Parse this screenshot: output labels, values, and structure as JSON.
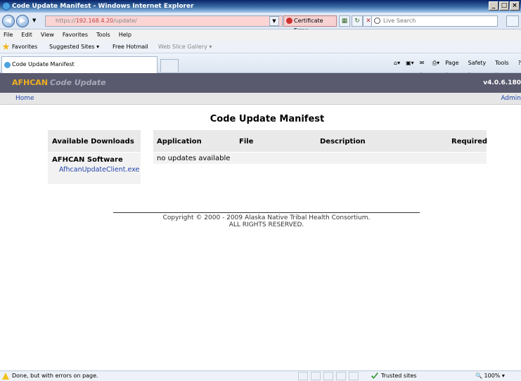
{
  "window": {
    "title": "Code Update Manifest - Windows Internet Explorer"
  },
  "address_bar": {
    "url_scheme": "https://",
    "url_host": "192.168.4.20",
    "url_path": "/update/",
    "cert_error_label": "Certificate Error",
    "search_placeholder": "Live Search"
  },
  "menu": [
    "File",
    "Edit",
    "View",
    "Favorites",
    "Tools",
    "Help"
  ],
  "favorites_bar": {
    "favorites_label": "Favorites",
    "items": [
      "Suggested Sites ▾",
      "Free Hotmail",
      "Web Slice Gallery ▾"
    ]
  },
  "tabs": {
    "active_tab_label": "Code Update Manifest"
  },
  "command_bar": [
    "Page ▾",
    "Safety ▾",
    "Tools ▾"
  ],
  "app": {
    "brand": "AFHCAN",
    "brand_sub": "Code Update",
    "version": "v4.0.6.180",
    "nav_home": "Home",
    "nav_admin": "Admin"
  },
  "page": {
    "title": "Code Update Manifest"
  },
  "downloads": {
    "header": "Available Downloads",
    "section_title": "AFHCAN Software",
    "file_link": "AfhcanUpdateClient.exe"
  },
  "manifest": {
    "columns": [
      "Application",
      "File",
      "Description",
      "Required"
    ],
    "empty_message": "no updates available"
  },
  "footer": {
    "line1": "Copyright © 2000 - 2009 Alaska Native Tribal Health Consortium.",
    "line2": "ALL RIGHTS RESERVED."
  },
  "status_bar": {
    "text": "Done, but with errors on page.",
    "zone": "Trusted sites",
    "zoom": "100%"
  },
  "colors": {
    "header_bg": "#5a5a6e",
    "brand": "#f0b020",
    "link": "#2244aa"
  }
}
